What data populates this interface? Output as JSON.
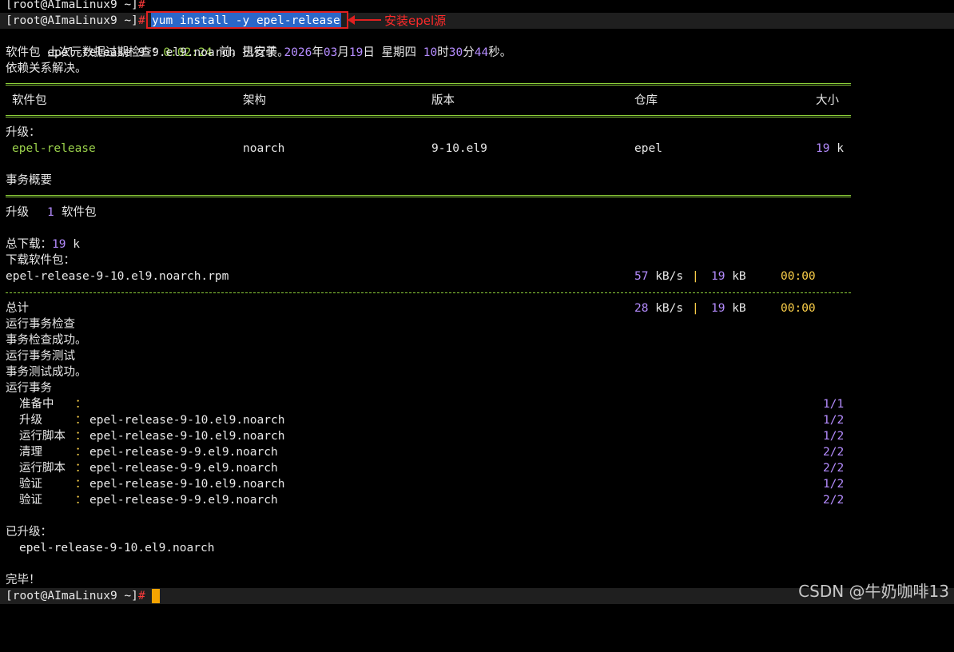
{
  "prompt": {
    "user_host": "[root@AImaLinux9 ~]",
    "symbol": "#"
  },
  "command": "yum install -y epel-release",
  "annotation": {
    "text": "安装epel源",
    "color": "#ff2a2a"
  },
  "meta": {
    "line1_prefix": "上次元数据过期检查：",
    "line1_time": "0:02:24",
    "line1_mid": " 前，执行于 ",
    "line1_year": "2026",
    "line1_y_unit": "年",
    "line1_month": "03",
    "line1_m_unit": "月",
    "line1_day": "19",
    "line1_d_unit": "日 星期四 ",
    "line1_hour": "10",
    "line1_h_unit": "时",
    "line1_min": "30",
    "line1_min_unit": "分",
    "line1_sec": "44",
    "line1_s_unit": "秒。",
    "line2": "软件包 epel-release-9-9.el9.noarch 已安装。",
    "line3": "依赖关系解决。"
  },
  "table": {
    "headers": [
      "软件包",
      "架构",
      "版本",
      "仓库",
      "大小"
    ],
    "section": "升级：",
    "rows": [
      {
        "package": "epel-release",
        "arch": "noarch",
        "version": "9-10.el9",
        "repo": "epel",
        "size_num": "19",
        "size_unit": " k"
      }
    ]
  },
  "summary": {
    "title": "事务概要",
    "upgrade_label": "升级",
    "upgrade_count": "1",
    "upgrade_unit": "软件包",
    "total_download_label": "总下载：",
    "total_download_num": "19",
    "total_download_unit": " k",
    "downloading_label": "下载软件包："
  },
  "downloads": [
    {
      "file": "epel-release-9-10.el9.noarch.rpm",
      "speed": "57",
      "speed_unit": " kB/s",
      "bar": "|",
      "size": "19",
      "size_unit": " kB",
      "time": "00:00"
    }
  ],
  "total": {
    "label": "总计",
    "speed": "28",
    "speed_unit": " kB/s",
    "bar": "|",
    "size": "19",
    "size_unit": " kB",
    "time": "00:00"
  },
  "steps": [
    "运行事务检查",
    "事务检查成功。",
    "运行事务测试",
    "事务测试成功。",
    "运行事务"
  ],
  "tx": [
    {
      "action": "准备中",
      "colon": "：",
      "pkg": "",
      "progress": "1/1"
    },
    {
      "action": "升级",
      "colon": "：",
      "pkg": "epel-release-9-10.el9.noarch",
      "progress": "1/2"
    },
    {
      "action": "运行脚本",
      "colon": "：",
      "pkg": "epel-release-9-10.el9.noarch",
      "progress": "1/2"
    },
    {
      "action": "清理",
      "colon": "：",
      "pkg": "epel-release-9-9.el9.noarch",
      "progress": "2/2"
    },
    {
      "action": "运行脚本",
      "colon": "：",
      "pkg": "epel-release-9-9.el9.noarch",
      "progress": "2/2"
    },
    {
      "action": "验证",
      "colon": "：",
      "pkg": "epel-release-9-10.el9.noarch",
      "progress": "1/2"
    },
    {
      "action": "验证",
      "colon": "：",
      "pkg": "epel-release-9-9.el9.noarch",
      "progress": "2/2"
    }
  ],
  "upgraded": {
    "label": "已升级：",
    "pkg": "epel-release-9-10.el9.noarch"
  },
  "done": "完毕！",
  "watermark": "CSDN @牛奶咖啡13",
  "colors": {
    "background": "#000000",
    "green": "#9bd24b",
    "purple": "#b58cff",
    "red": "#ff3b3b",
    "yellow": "#ffd24a"
  }
}
